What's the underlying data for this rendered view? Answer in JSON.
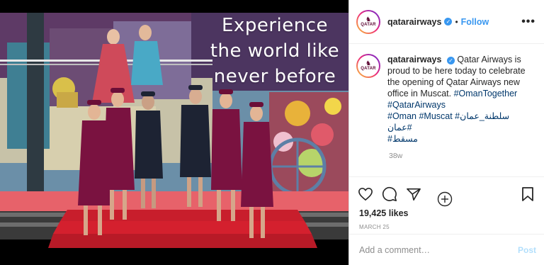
{
  "photo": {
    "banner_lines": [
      "Experience",
      "the world like",
      "never before"
    ]
  },
  "header": {
    "username": "qatarairways",
    "separator": "•",
    "follow_label": "Follow",
    "more_label": "•••",
    "avatar_text": "QATAR"
  },
  "caption": {
    "username": "qatarairways",
    "text": "Qatar Airways is proud to be here today to celebrate the opening of Qatar Airways new office in Muscat.",
    "hashtags_line1": "#OmanTogether",
    "hashtags_line2": "#QatarAirways",
    "hashtags_line3": "#Oman #Muscat #سلطنة_عمان #عمان",
    "hashtags_line4": "#مسقط",
    "time": "38w"
  },
  "actions": {
    "likes": "19,425 likes",
    "date": "MARCH 25"
  },
  "comment_box": {
    "placeholder": "Add a comment…",
    "post_label": "Post"
  },
  "colors": {
    "link_blue": "#3897f0",
    "hashtag": "#00376b",
    "uniform_burgundy": "#7a1240",
    "uniform_navy": "#1d2333",
    "carpet_red": "#d4202e"
  },
  "icons": [
    "heart-icon",
    "comment-icon",
    "share-icon",
    "bookmark-icon",
    "more-options-icon",
    "verified-badge-icon",
    "load-more-icon"
  ]
}
